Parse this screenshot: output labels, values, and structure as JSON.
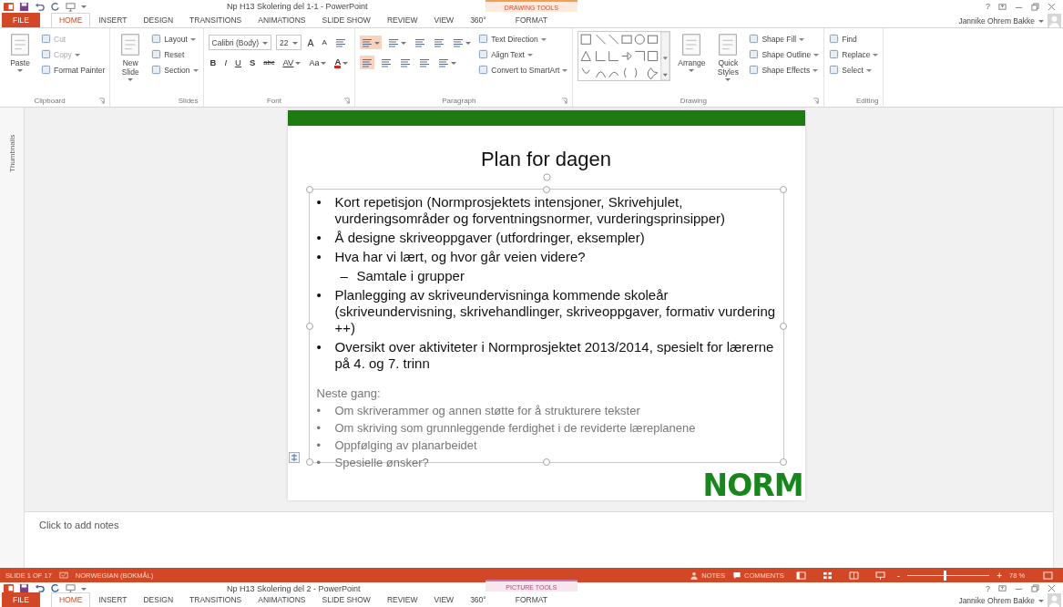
{
  "window": {
    "title": "Np H13 Skolering del 1-1 - PowerPoint",
    "context_group": "DRAWING TOOLS",
    "help": "?",
    "user": "Jannike Ohrem Bakke"
  },
  "tabs": [
    {
      "label": "FILE",
      "kind": "file",
      "selected": false
    },
    {
      "label": "HOME",
      "kind": "normal",
      "selected": true
    },
    {
      "label": "INSERT",
      "kind": "normal",
      "selected": false
    },
    {
      "label": "DESIGN",
      "kind": "normal",
      "selected": false
    },
    {
      "label": "TRANSITIONS",
      "kind": "normal",
      "selected": false
    },
    {
      "label": "ANIMATIONS",
      "kind": "normal",
      "selected": false
    },
    {
      "label": "SLIDE SHOW",
      "kind": "normal",
      "selected": false
    },
    {
      "label": "REVIEW",
      "kind": "normal",
      "selected": false
    },
    {
      "label": "VIEW",
      "kind": "normal",
      "selected": false
    },
    {
      "label": "360°",
      "kind": "normal",
      "selected": false
    },
    {
      "label": "FORMAT",
      "kind": "context",
      "selected": false
    }
  ],
  "ribbon": [
    {
      "label": "Clipboard",
      "launcher": true,
      "columns": [
        {
          "kind": "large",
          "label": "Paste",
          "dropdown": true
        },
        {
          "kind": "stack",
          "items": [
            {
              "label": "Cut",
              "disabled": true,
              "dropdown": false
            },
            {
              "label": "Copy",
              "disabled": true,
              "dropdown": true
            },
            {
              "label": "Format Painter",
              "disabled": false,
              "dropdown": false
            }
          ]
        }
      ]
    },
    {
      "label": "Slides",
      "launcher": false,
      "columns": [
        {
          "kind": "large",
          "label": "New Slide",
          "dropdown": true
        },
        {
          "kind": "stack",
          "items": [
            {
              "label": "Layout",
              "disabled": false,
              "dropdown": true
            },
            {
              "label": "Reset",
              "disabled": false,
              "dropdown": false
            },
            {
              "label": "Section",
              "disabled": false,
              "dropdown": true
            }
          ]
        }
      ]
    },
    {
      "label": "Font",
      "launcher": true,
      "columns": [
        {
          "kind": "rows",
          "rows": [
            {
              "items": [
                {
                  "kind": "field",
                  "text": "Calibri (Body)",
                  "dropdown": true
                },
                {
                  "kind": "field",
                  "text": "22",
                  "dropdown": true
                },
                {
                  "kind": "glyph",
                  "text": "A",
                  "dropdown": false
                },
                {
                  "kind": "glyph",
                  "text": "A",
                  "dropdown": false
                },
                {
                  "kind": "tool",
                  "dropdown": false,
                  "selected": false
                }
              ]
            },
            {
              "items": [
                {
                  "kind": "glyph",
                  "text": "B",
                  "dropdown": false
                },
                {
                  "kind": "glyph",
                  "text": "I",
                  "dropdown": false
                },
                {
                  "kind": "glyph",
                  "text": "U",
                  "dropdown": false
                },
                {
                  "kind": "glyph",
                  "text": "S",
                  "dropdown": false
                },
                {
                  "kind": "glyph",
                  "text": "abc",
                  "dropdown": false
                },
                {
                  "kind": "glyph",
                  "text": "AV",
                  "dropdown": true
                },
                {
                  "kind": "glyph",
                  "text": "Aa",
                  "dropdown": true
                },
                {
                  "kind": "glyph",
                  "text": "A",
                  "dropdown": true
                }
              ]
            }
          ]
        }
      ]
    },
    {
      "label": "Paragraph",
      "launcher": true,
      "columns": [
        {
          "kind": "rows",
          "rows": [
            {
              "items": [
                {
                  "kind": "tool",
                  "dropdown": true,
                  "selected": true
                },
                {
                  "kind": "tool",
                  "dropdown": true,
                  "selected": false
                },
                {
                  "kind": "tool",
                  "dropdown": false,
                  "selected": false
                },
                {
                  "kind": "tool",
                  "dropdown": false,
                  "selected": false
                },
                {
                  "kind": "tool",
                  "dropdown": true,
                  "selected": false
                }
              ]
            },
            {
              "items": [
                {
                  "kind": "tool",
                  "dropdown": false,
                  "selected": true
                },
                {
                  "kind": "tool",
                  "dropdown": false,
                  "selected": false
                },
                {
                  "kind": "tool",
                  "dropdown": false,
                  "selected": false
                },
                {
                  "kind": "tool",
                  "dropdown": false,
                  "selected": false
                },
                {
                  "kind": "tool",
                  "dropdown": true,
                  "selected": false
                }
              ]
            }
          ]
        },
        {
          "kind": "stack",
          "items": [
            {
              "label": "Text Direction",
              "disabled": false,
              "dropdown": true
            },
            {
              "label": "Align Text",
              "disabled": false,
              "dropdown": true
            },
            {
              "label": "Convert to SmartArt",
              "disabled": false,
              "dropdown": true
            }
          ]
        }
      ]
    },
    {
      "label": "Drawing",
      "launcher": true,
      "columns": [
        {
          "kind": "gallery"
        },
        {
          "kind": "large",
          "label": "Arrange",
          "dropdown": true
        },
        {
          "kind": "large",
          "label": "Quick Styles",
          "dropdown": true
        },
        {
          "kind": "stack",
          "items": [
            {
              "label": "Shape Fill",
              "disabled": false,
              "dropdown": true
            },
            {
              "label": "Shape Outline",
              "disabled": false,
              "dropdown": true
            },
            {
              "label": "Shape Effects",
              "disabled": false,
              "dropdown": true
            }
          ]
        }
      ]
    },
    {
      "label": "Editing",
      "launcher": false,
      "columns": [
        {
          "kind": "stack",
          "items": [
            {
              "label": "Find",
              "disabled": false,
              "dropdown": false
            },
            {
              "label": "Replace",
              "disabled": false,
              "dropdown": true
            },
            {
              "label": "Select",
              "disabled": false,
              "dropdown": true
            }
          ]
        }
      ]
    }
  ],
  "thumbnails_pane": {
    "label": "Thumbnails"
  },
  "slide": {
    "title": "Plan for dagen",
    "bullets": [
      {
        "marker": "•",
        "text": "Kort repetisjon (Normprosjektets intensjoner, Skrivehjulet, vurderingsområder og forventningsnormer, vurderingsprinsipper)"
      },
      {
        "marker": "•",
        "text": "Å designe skriveoppgaver (utfordringer, eksempler)"
      },
      {
        "marker": "•",
        "text": "Hva har vi lært, og hvor går veien videre?",
        "children": [
          {
            "marker": "–",
            "text": "Samtale i grupper"
          }
        ]
      },
      {
        "marker": "•",
        "text": "Planlegging av skriveundervisninga kommende skoleår (skriveundervisning, skrivehandlinger, skriveoppgaver, formativ vurdering ++)"
      },
      {
        "marker": "•",
        "text": "Oversikt over aktiviteter i Normprosjektet 2013/2014, spesielt for lærerne på 4. og 7. trinn"
      }
    ],
    "next_heading": "Neste gang:",
    "next_items": [
      {
        "marker": "•",
        "text": "Om skriverammer og annen støtte for å strukturere tekster"
      },
      {
        "marker": "•",
        "text": "Om skriving som grunnleggende ferdighet i de reviderte læreplanene"
      },
      {
        "marker": "•",
        "text": "Oppfølging av planarbeidet"
      },
      {
        "marker": "•",
        "text": "Spesielle ønsker?"
      }
    ],
    "logo": "NORM"
  },
  "notes": {
    "placeholder": "Click to add notes"
  },
  "status_bar": {
    "slide": "SLIDE 1 OF 17",
    "language": "NORWEGIAN (BOKMÅL)",
    "notes": "NOTES",
    "comments": "COMMENTS",
    "zoom_out": "-",
    "zoom_in": "+",
    "zoom": {
      "level": 0.45
    },
    "zoom_reading": "78 %"
  },
  "second_window": {
    "title": "Np H13 Skolering del 2 - PowerPoint",
    "context_group": "PICTURE TOOLS",
    "help": "?",
    "user": "Jannike Ohrem Bakke",
    "tabs": [
      {
        "label": "FILE",
        "kind": "file",
        "selected": false
      },
      {
        "label": "HOME",
        "kind": "normal",
        "selected": true
      },
      {
        "label": "INSERT",
        "kind": "normal",
        "selected": false
      },
      {
        "label": "DESIGN",
        "kind": "normal",
        "selected": false
      },
      {
        "label": "TRANSITIONS",
        "kind": "normal",
        "selected": false
      },
      {
        "label": "ANIMATIONS",
        "kind": "normal",
        "selected": false
      },
      {
        "label": "SLIDE SHOW",
        "kind": "normal",
        "selected": false
      },
      {
        "label": "REVIEW",
        "kind": "normal",
        "selected": false
      },
      {
        "label": "VIEW",
        "kind": "normal",
        "selected": false
      },
      {
        "label": "360°",
        "kind": "normal",
        "selected": false
      },
      {
        "label": "FORMAT",
        "kind": "context",
        "selected": false
      }
    ]
  }
}
